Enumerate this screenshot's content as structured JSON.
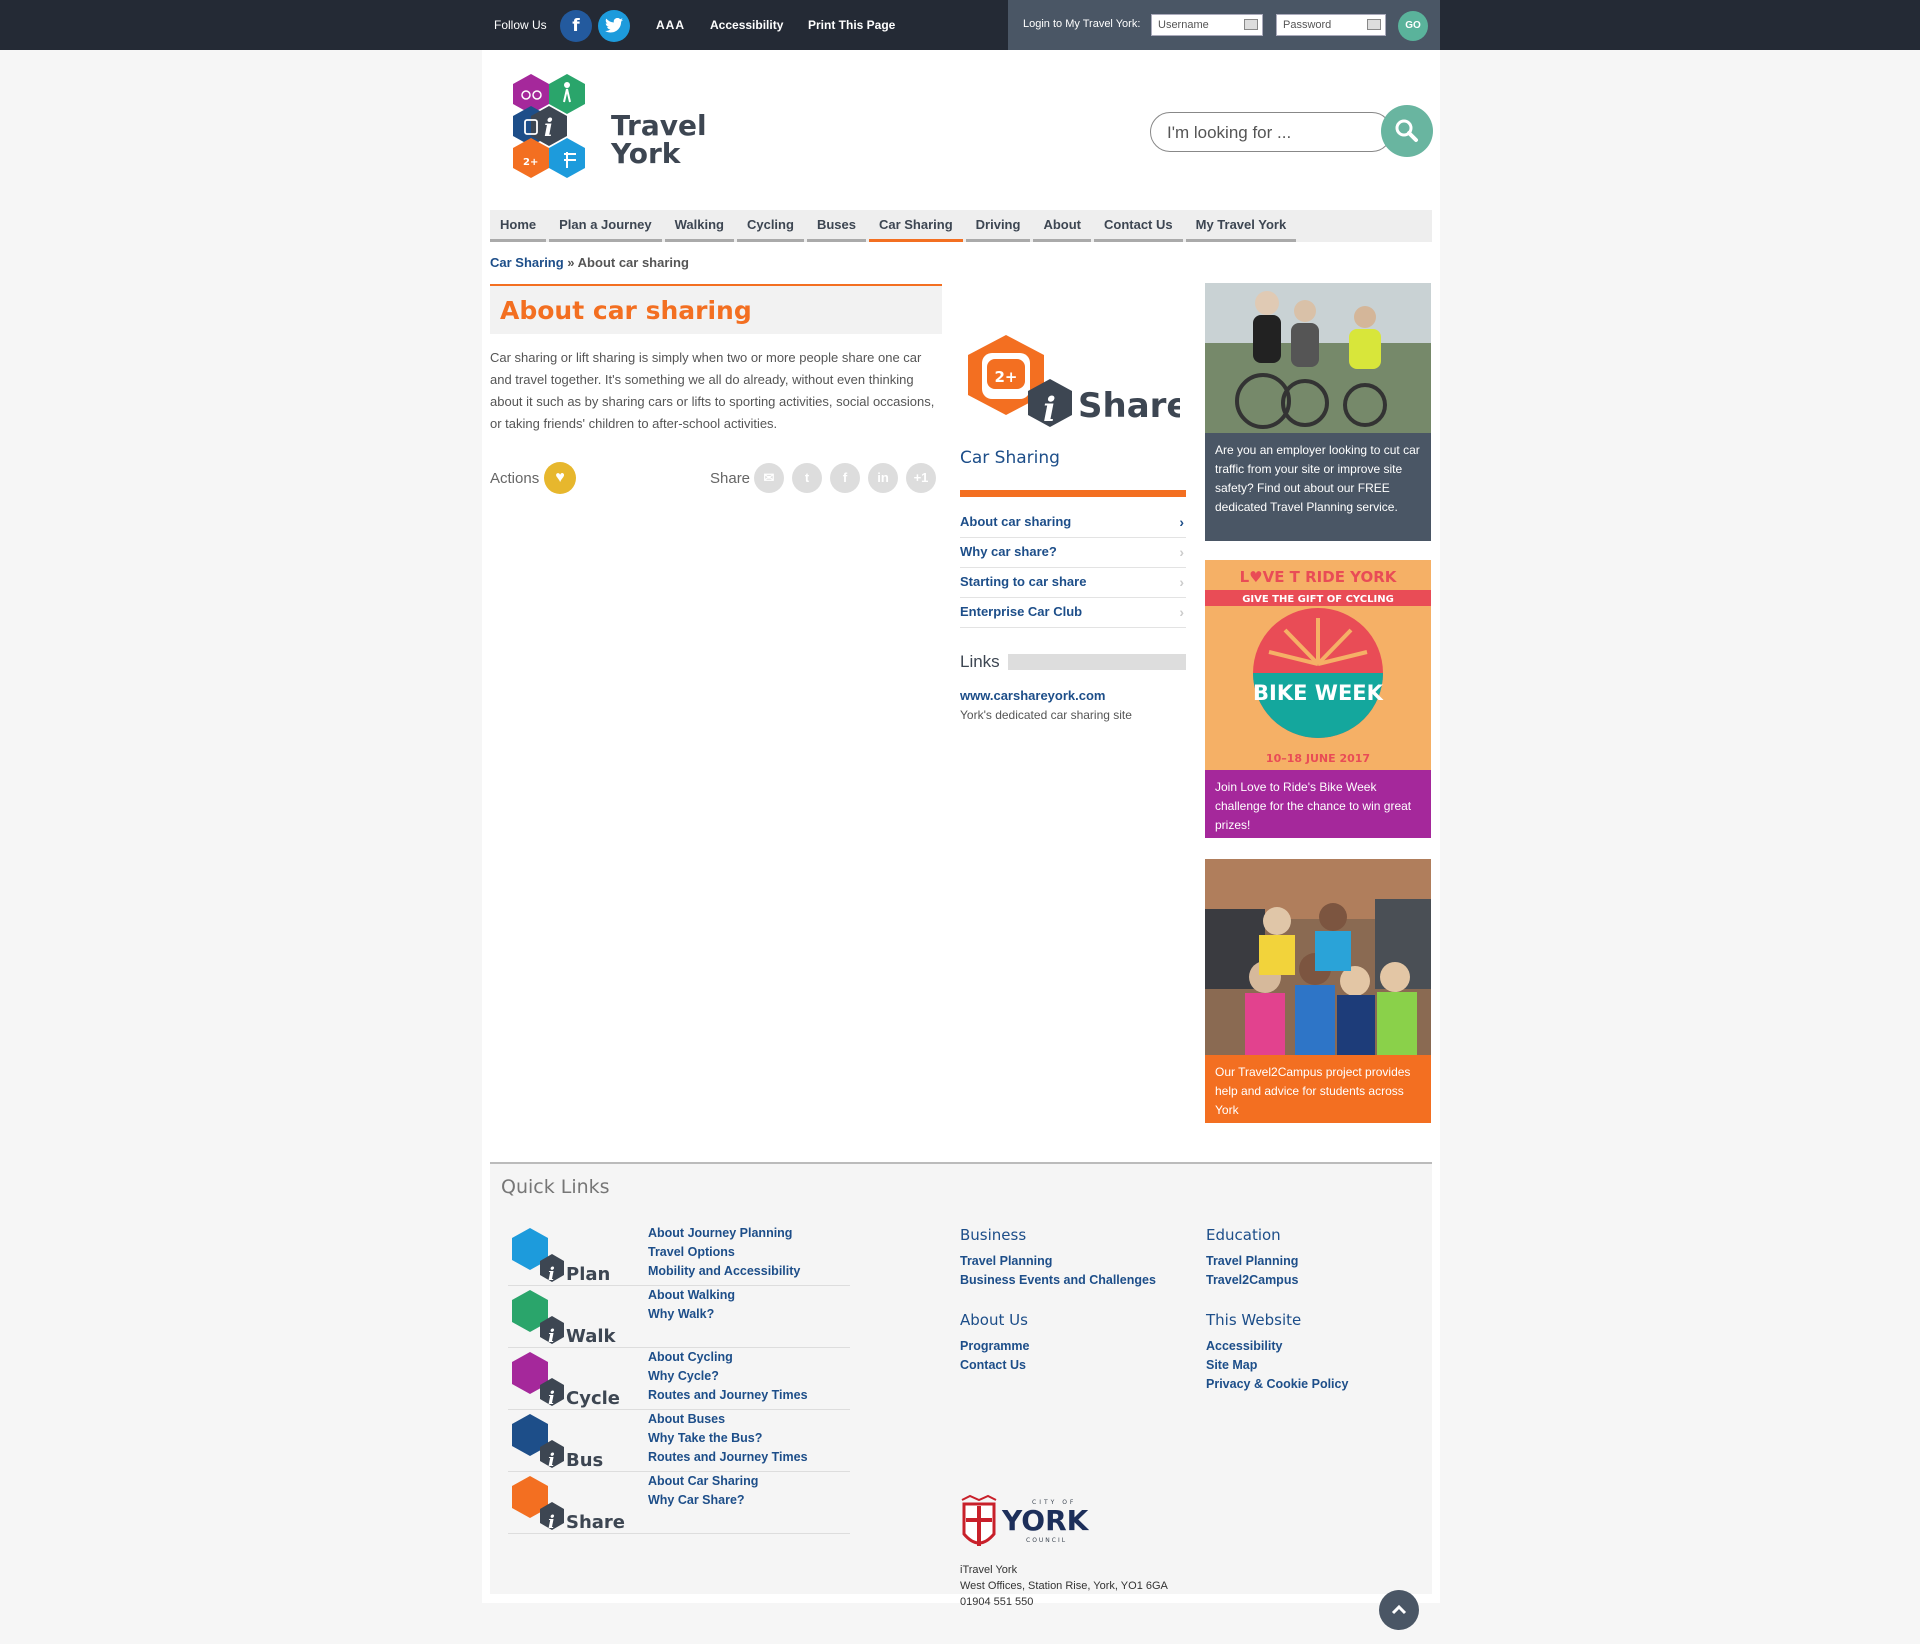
{
  "topbar": {
    "follow_label": "Follow Us",
    "facebook": "f",
    "twitter": "t",
    "text_size": "AAA",
    "accessibility": "Accessibility",
    "print": "Print This Page",
    "login_label": "Login to My Travel York:",
    "username_placeholder": "Username",
    "password_placeholder": "Password",
    "go": "GO"
  },
  "logo": {
    "line1": "Travel",
    "line2": "York"
  },
  "search": {
    "placeholder": "I'm looking for ..."
  },
  "nav": [
    "Home",
    "Plan a Journey",
    "Walking",
    "Cycling",
    "Buses",
    "Car Sharing",
    "Driving",
    "About",
    "Contact Us",
    "My Travel York"
  ],
  "nav_active": "Car Sharing",
  "breadcrumb": {
    "parent": "Car Sharing",
    "sep": " » ",
    "current": "About car sharing"
  },
  "main": {
    "title": "About car sharing",
    "intro": "Car sharing or lift sharing is simply when two or more people share one car and travel together. It's something we all do already, without even thinking about it such as by sharing cars or lifts to sporting activities, social occasions, or taking friends' children to after-school activities.",
    "actions_label": "Actions",
    "share_label": "Share",
    "share_plus": "+1"
  },
  "side": {
    "brand": "Share",
    "badge": "2+",
    "heading": "Car Sharing",
    "items": [
      "About car sharing",
      "Why car share?",
      "Starting to car share",
      "Enterprise Car Club"
    ],
    "links_label": "Links",
    "link_url": "www.carshareyork.com",
    "link_desc": "York's dedicated car sharing site"
  },
  "promos": [
    {
      "caption": "Are you an employer looking to cut car traffic from your site or improve site safety? Find out about our FREE dedicated Travel Planning service.",
      "color": "#4a5665"
    },
    {
      "caption": "Join Love to Ride's Bike Week challenge for the chance to win great prizes!",
      "color": "#a5289b",
      "banner_title": "L♥VE T  RIDE YORK",
      "banner_sub": "GIVE THE GIFT OF CYCLING",
      "banner_main": "BIKE WEEK",
      "banner_date": "10–18 JUNE 2017"
    },
    {
      "caption": "Our Travel2Campus project provides help and advice for students across York",
      "color": "#f36f21"
    }
  ],
  "footer": {
    "quick_links": "Quick Links",
    "groups": [
      {
        "brand": "Plan",
        "links": [
          "About Journey Planning",
          "Travel Options",
          "Mobility and Accessibility"
        ]
      },
      {
        "brand": "Walk",
        "links": [
          "About Walking",
          "Why Walk?"
        ]
      },
      {
        "brand": "Cycle",
        "links": [
          "About Cycling",
          "Why Cycle?",
          "Routes and Journey Times"
        ]
      },
      {
        "brand": "Bus",
        "links": [
          "About Buses",
          "Why Take the Bus?",
          "Routes and Journey Times"
        ]
      },
      {
        "brand": "Share",
        "links": [
          "About Car Sharing",
          "Why Car Share?"
        ]
      }
    ],
    "business": {
      "heading": "Business",
      "links": [
        "Travel Planning",
        "Business Events and Challenges"
      ]
    },
    "education": {
      "heading": "Education",
      "links": [
        "Travel Planning",
        "Travel2Campus"
      ]
    },
    "about": {
      "heading": "About Us",
      "links": [
        "Programme",
        "Contact Us"
      ]
    },
    "website": {
      "heading": "This Website",
      "links": [
        "Accessibility",
        "Site Map",
        "Privacy & Cookie Policy"
      ]
    },
    "council": {
      "top": "CITY OF",
      "name": "YORK",
      "bottom": "COUNCIL"
    },
    "address": [
      "iTravel York",
      "West Offices, Station Rise, York, YO1 6GA",
      "01904 551 550"
    ]
  },
  "colors": {
    "accent": "#f36f21",
    "link": "#1d4e89",
    "dark": "#242a35"
  }
}
